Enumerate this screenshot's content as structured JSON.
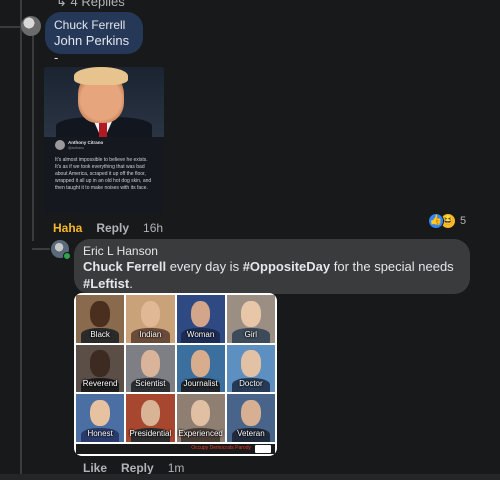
{
  "thread": {
    "replies_label": "4 Replies"
  },
  "comment1": {
    "author": "Chuck Ferrell",
    "text": "John Perkins -",
    "actions": {
      "reaction": "Haha",
      "reply": "Reply",
      "time": "16h"
    },
    "shared_post": {
      "tweet_name": "Anthony Citrano",
      "tweet_handle": "@acitrano",
      "tweet_text": "It's almost impossible to believe he exists. It's as if we took everything that was bad about America, scraped it up off the floor, wrapped it all up in an old hot dog skin, and then taught it to make noises with its face."
    },
    "reaction_count": "5",
    "reaction_icons": [
      "like-icon",
      "haha-icon"
    ]
  },
  "comment2": {
    "author": "Eric L Hanson",
    "mention": "Chuck Ferrell",
    "text_middle": " every day is ",
    "hashtag1": "#OppositeDay",
    "text_end": " for the special needs ",
    "hashtag2": "#Leftist",
    "text_period": ".",
    "actions": {
      "like": "Like",
      "reply": "Reply",
      "time": "1m"
    },
    "meme": {
      "labels": [
        "Black",
        "Indian",
        "Woman",
        "Girl",
        "Reverend",
        "Scientist",
        "Journalist",
        "Doctor",
        "Honest",
        "Presidential",
        "Experienced",
        "Veteran"
      ],
      "footer": "Occupy Democrats Parody"
    }
  },
  "colors": {
    "background": "#18191a",
    "bubble": "#3a3b3c",
    "bubble_highlight": "#253858",
    "haha": "#f7b928",
    "like": "#2d88ff"
  }
}
